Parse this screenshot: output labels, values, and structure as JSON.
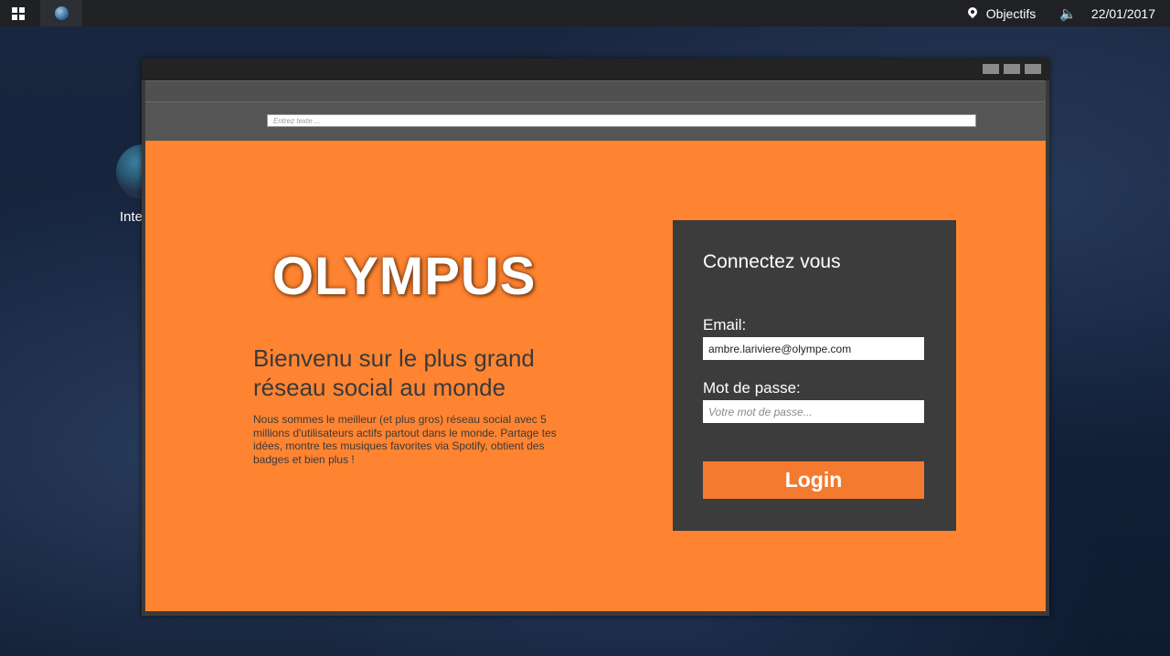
{
  "taskbar": {
    "objectives_label": "Objectifs",
    "date": "22/01/2017"
  },
  "desktop": {
    "icons": [
      {
        "label": "Inte"
      }
    ]
  },
  "browser": {
    "address_placeholder": "Entrez texte ..."
  },
  "page": {
    "logo": "OLYMPUS",
    "headline": "Bienvenu sur le plus grand réseau social au monde",
    "description": "Nous sommes le meilleur (et plus gros) réseau social avec 5 millions d'utilisateurs actifs partout dans le monde. Partage tes idées, montre tes musiques favorites via Spotify, obtient des badges et bien plus !",
    "login": {
      "title": "Connectez vous",
      "email_label": "Email:",
      "email_value": "ambre.lariviere@olympe.com",
      "password_label": "Mot de passe:",
      "password_placeholder": "Votre mot de passe...",
      "button_label": "Login"
    }
  },
  "colors": {
    "page_background": "#ff8431",
    "login_panel": "#3c3c3c",
    "login_button": "#f37a2f"
  }
}
